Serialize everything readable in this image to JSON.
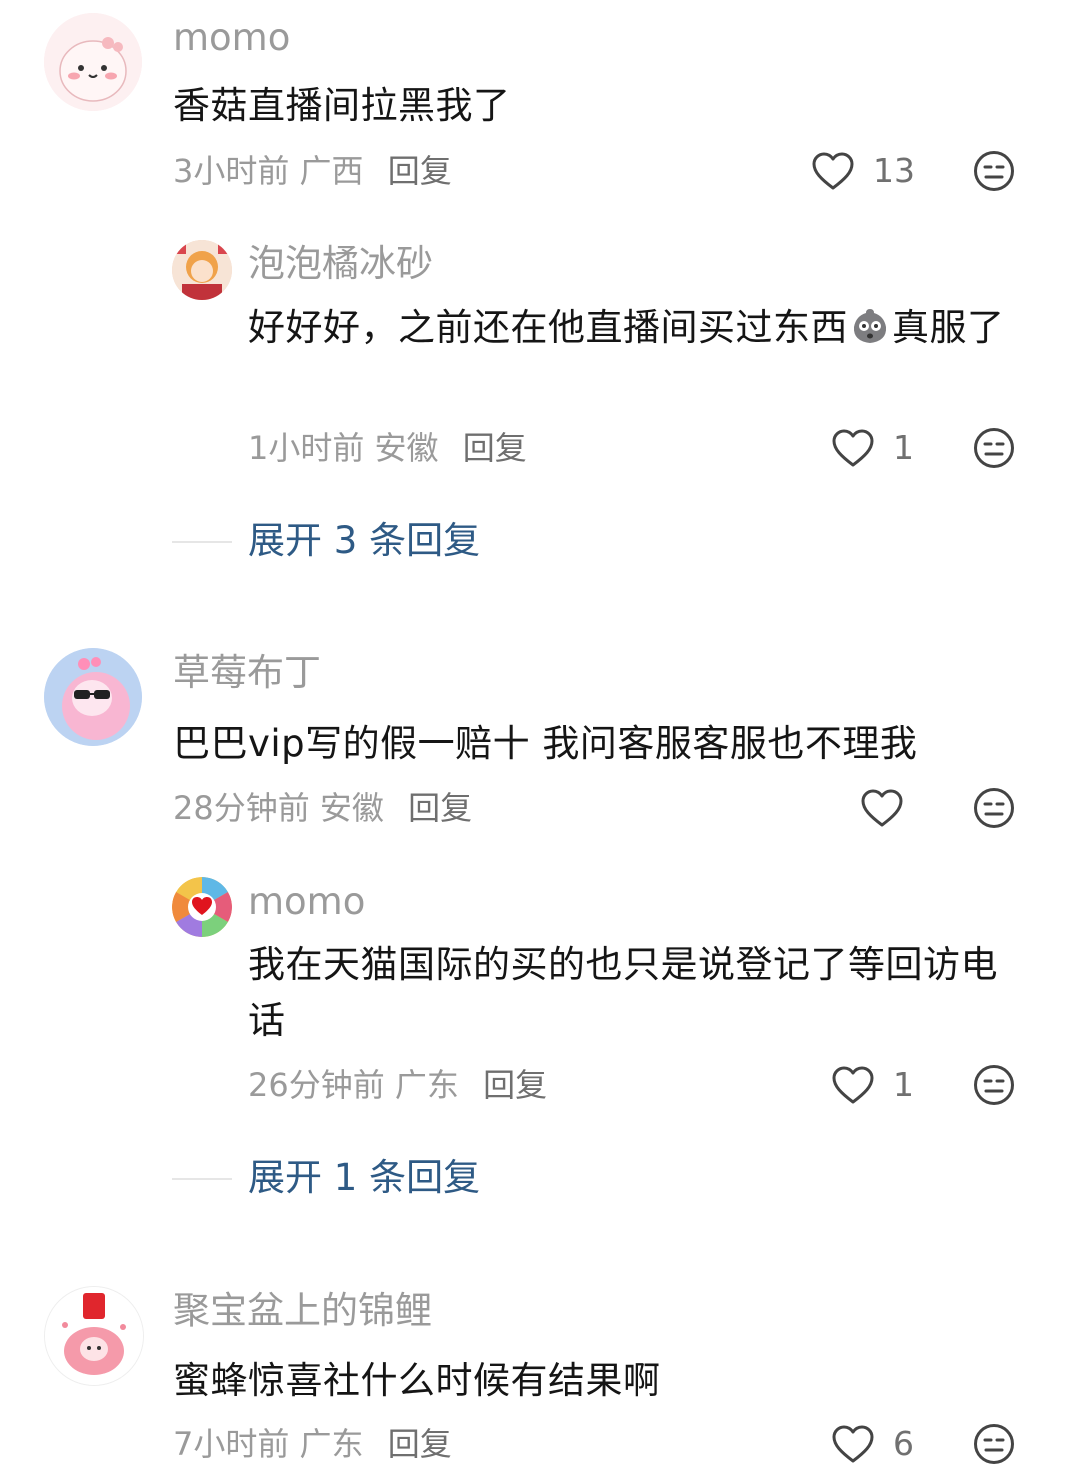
{
  "comments": [
    {
      "user": "momo",
      "text": "香菇直播间拉黑我了",
      "time": "3小时前",
      "location": "广西",
      "reply_label": "回复",
      "likes": "13",
      "replies": [
        {
          "user": "泡泡橘冰砂",
          "text_before": "好好好，之前还在他直播间买过东西",
          "text_after": "真服了",
          "time": "1小时前",
          "location": "安徽",
          "reply_label": "回复",
          "likes": "1"
        }
      ],
      "expand_label": "展开 3 条回复"
    },
    {
      "user": "草莓布丁",
      "text": "巴巴vip写的假一赔十 我问客服客服也不理我",
      "time": "28分钟前",
      "location": "安徽",
      "reply_label": "回复",
      "likes": "",
      "replies": [
        {
          "user": "momo",
          "text": "我在天猫国际的买的也只是说登记了等回访电话",
          "time": "26分钟前",
          "location": "广东",
          "reply_label": "回复",
          "likes": "1"
        }
      ],
      "expand_label": "展开 1 条回复"
    },
    {
      "user": "聚宝盆上的锦鲤",
      "text": "蜜蜂惊喜社什么时候有结果啊",
      "time": "7小时前",
      "location": "广东",
      "reply_label": "回复",
      "likes": "6"
    }
  ],
  "icons": {
    "like": "heart-outline-icon",
    "dislike": "meh-face-icon",
    "inline_emoji": "shocked-face-emoji"
  },
  "colors": {
    "username": "#9a9a9a",
    "content": "#151515",
    "expand_link": "#2e5a85"
  }
}
